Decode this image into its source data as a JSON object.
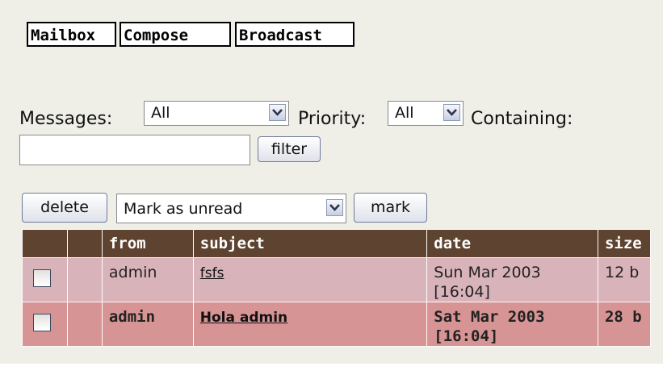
{
  "tabs": [
    "Mailbox",
    "Compose",
    "Broadcast"
  ],
  "filter": {
    "messages_label": "Messages:",
    "messages_value": "All",
    "priority_label": "Priority:",
    "priority_value": "All",
    "containing_label": "Containing:",
    "containing_value": "",
    "filter_button": "filter"
  },
  "actions": {
    "delete_button": "delete",
    "mark_select_value": "Mark as unread",
    "mark_button": "mark"
  },
  "table": {
    "columns": [
      "",
      "",
      "from",
      "subject",
      "date",
      "size"
    ],
    "rows": [
      {
        "from": "admin",
        "subject": "fsfs",
        "date_line1": "Sun Mar 2003",
        "date_line2": "[16:04]",
        "size": "12 b",
        "unread": false
      },
      {
        "from": "admin",
        "subject": "Hola admin",
        "date_line1": "Sat Mar 2003",
        "date_line2": "[16:04]",
        "size": "28 b",
        "unread": true
      }
    ]
  },
  "colors": {
    "panel_bg": "#efefe8",
    "header_bg": "#5e4330",
    "row_read_bg": "#d9b3ba",
    "row_unread_bg": "#d79494"
  },
  "icons": {
    "dropdown": "chevron-down-icon"
  }
}
